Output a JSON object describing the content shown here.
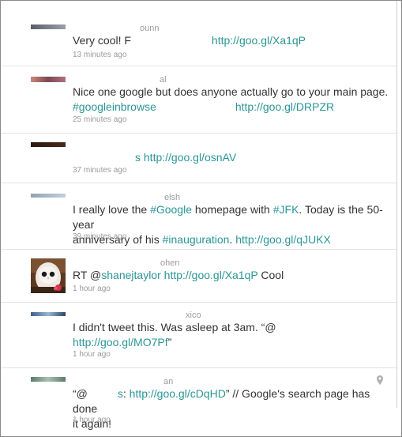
{
  "tweets": [
    {
      "username_fragment": "ounn",
      "text_pre": "Very cool! F",
      "link": "http://goo.gl/Xa1qP",
      "time": "13 minutes ago"
    },
    {
      "username_fragment": "al",
      "text_line1": "Nice one google but does anyone actually go to your main page.",
      "hashtag": "#googleinbrowse",
      "link": "http://goo.gl/DRPZR",
      "time": "25 minutes ago"
    },
    {
      "fragment": "s",
      "link": "http://goo.gl/osnAV",
      "time": "37 minutes ago"
    },
    {
      "username_fragment": "elsh",
      "t1": "I really love the ",
      "tag1": "#Google",
      "t2": " homepage with ",
      "tag2": "#JFK",
      "t3": ". Today is the 50-year",
      "t4": "anniversary of his ",
      "tag3": "#inauguration",
      "t5": ". ",
      "link": "http://goo.gl/qJUKX",
      "time": "39 minutes ago"
    },
    {
      "username_fragment": "ohen",
      "t1": "RT @",
      "mention": "shanejtaylor",
      "link": "http://goo.gl/Xa1qP",
      "t2": " Cool",
      "time": "1 hour ago"
    },
    {
      "username_fragment": "xico",
      "t1": "I didn't tweet this. Was asleep at 3am. “@",
      "link": "http://goo.gl/MO7Pf",
      "t2": "”",
      "time": "1 hour ago"
    },
    {
      "username_fragment": "an",
      "t1": "“@",
      "t2": "s",
      "t3": ": ",
      "link": "http://goo.gl/cDqHD",
      "t4": "” // Google's search page has done",
      "t5": "it again!",
      "time": "1 hour ago"
    }
  ],
  "colors": {
    "link": "#2a9596",
    "text": "#333333",
    "meta": "#9a9a9a"
  }
}
